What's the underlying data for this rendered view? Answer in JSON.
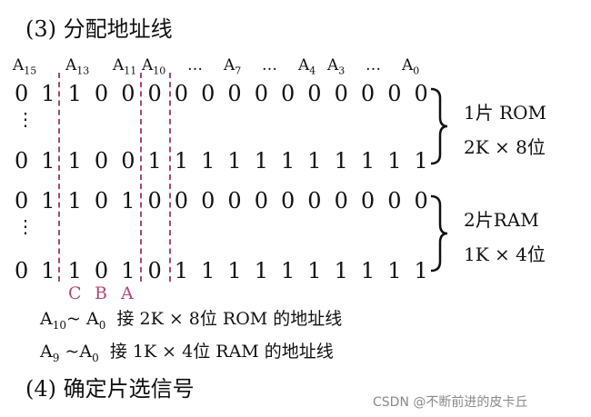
{
  "heading_3": "(3) 分配地址线",
  "address_labels": {
    "a15": {
      "base": "A",
      "sub": "15"
    },
    "a13": {
      "base": "A",
      "sub": "13"
    },
    "a11": {
      "base": "A",
      "sub": "11"
    },
    "a10": {
      "base": "A",
      "sub": "10"
    },
    "dots1": "…",
    "a7": {
      "base": "A",
      "sub": "7"
    },
    "dots2": "…",
    "a4": {
      "base": "A",
      "sub": "4"
    },
    "a3": {
      "base": "A",
      "sub": "3"
    },
    "dots3": "…",
    "a0": {
      "base": "A",
      "sub": "0"
    }
  },
  "rows": [
    [
      "0",
      "1",
      "1",
      "0",
      "0",
      "0",
      "0",
      "0",
      "0",
      "0",
      "0",
      "0",
      "0",
      "0",
      "0",
      "0"
    ],
    [
      "0",
      "1",
      "1",
      "0",
      "0",
      "1",
      "1",
      "1",
      "1",
      "1",
      "1",
      "1",
      "1",
      "1",
      "1",
      "1"
    ],
    [
      "0",
      "1",
      "1",
      "0",
      "1",
      "0",
      "0",
      "0",
      "0",
      "0",
      "0",
      "0",
      "0",
      "0",
      "0",
      "0"
    ],
    [
      "0",
      "1",
      "1",
      "0",
      "1",
      "0",
      "1",
      "1",
      "1",
      "1",
      "1",
      "1",
      "1",
      "1",
      "1",
      "1"
    ]
  ],
  "vdots": "⋮",
  "rom_group": {
    "line1": "1片 ROM",
    "line2": "2K × 8位"
  },
  "ram_group": {
    "line1": "2片RAM",
    "line2": "1K × 4位"
  },
  "cba": [
    "C",
    "B",
    "A"
  ],
  "note_rom": {
    "from": {
      "base": "A",
      "sub": "10"
    },
    "tilde": "~",
    "to": {
      "base": "A",
      "sub": "0"
    },
    "text": "接 2K × 8位 ROM 的地址线"
  },
  "note_ram": {
    "from": {
      "base": "A",
      "sub": "9"
    },
    "tilde": "~",
    "to": {
      "base": "A",
      "sub": "0"
    },
    "text": "接 1K × 4位 RAM 的地址线"
  },
  "heading_4": "(4) 确定片选信号",
  "watermark": "CSDN @不断前进的皮卡丘",
  "colors": {
    "dashed_line": "#a24a74",
    "cba_label": "#b04a78",
    "watermark": "#8a8a8a"
  }
}
